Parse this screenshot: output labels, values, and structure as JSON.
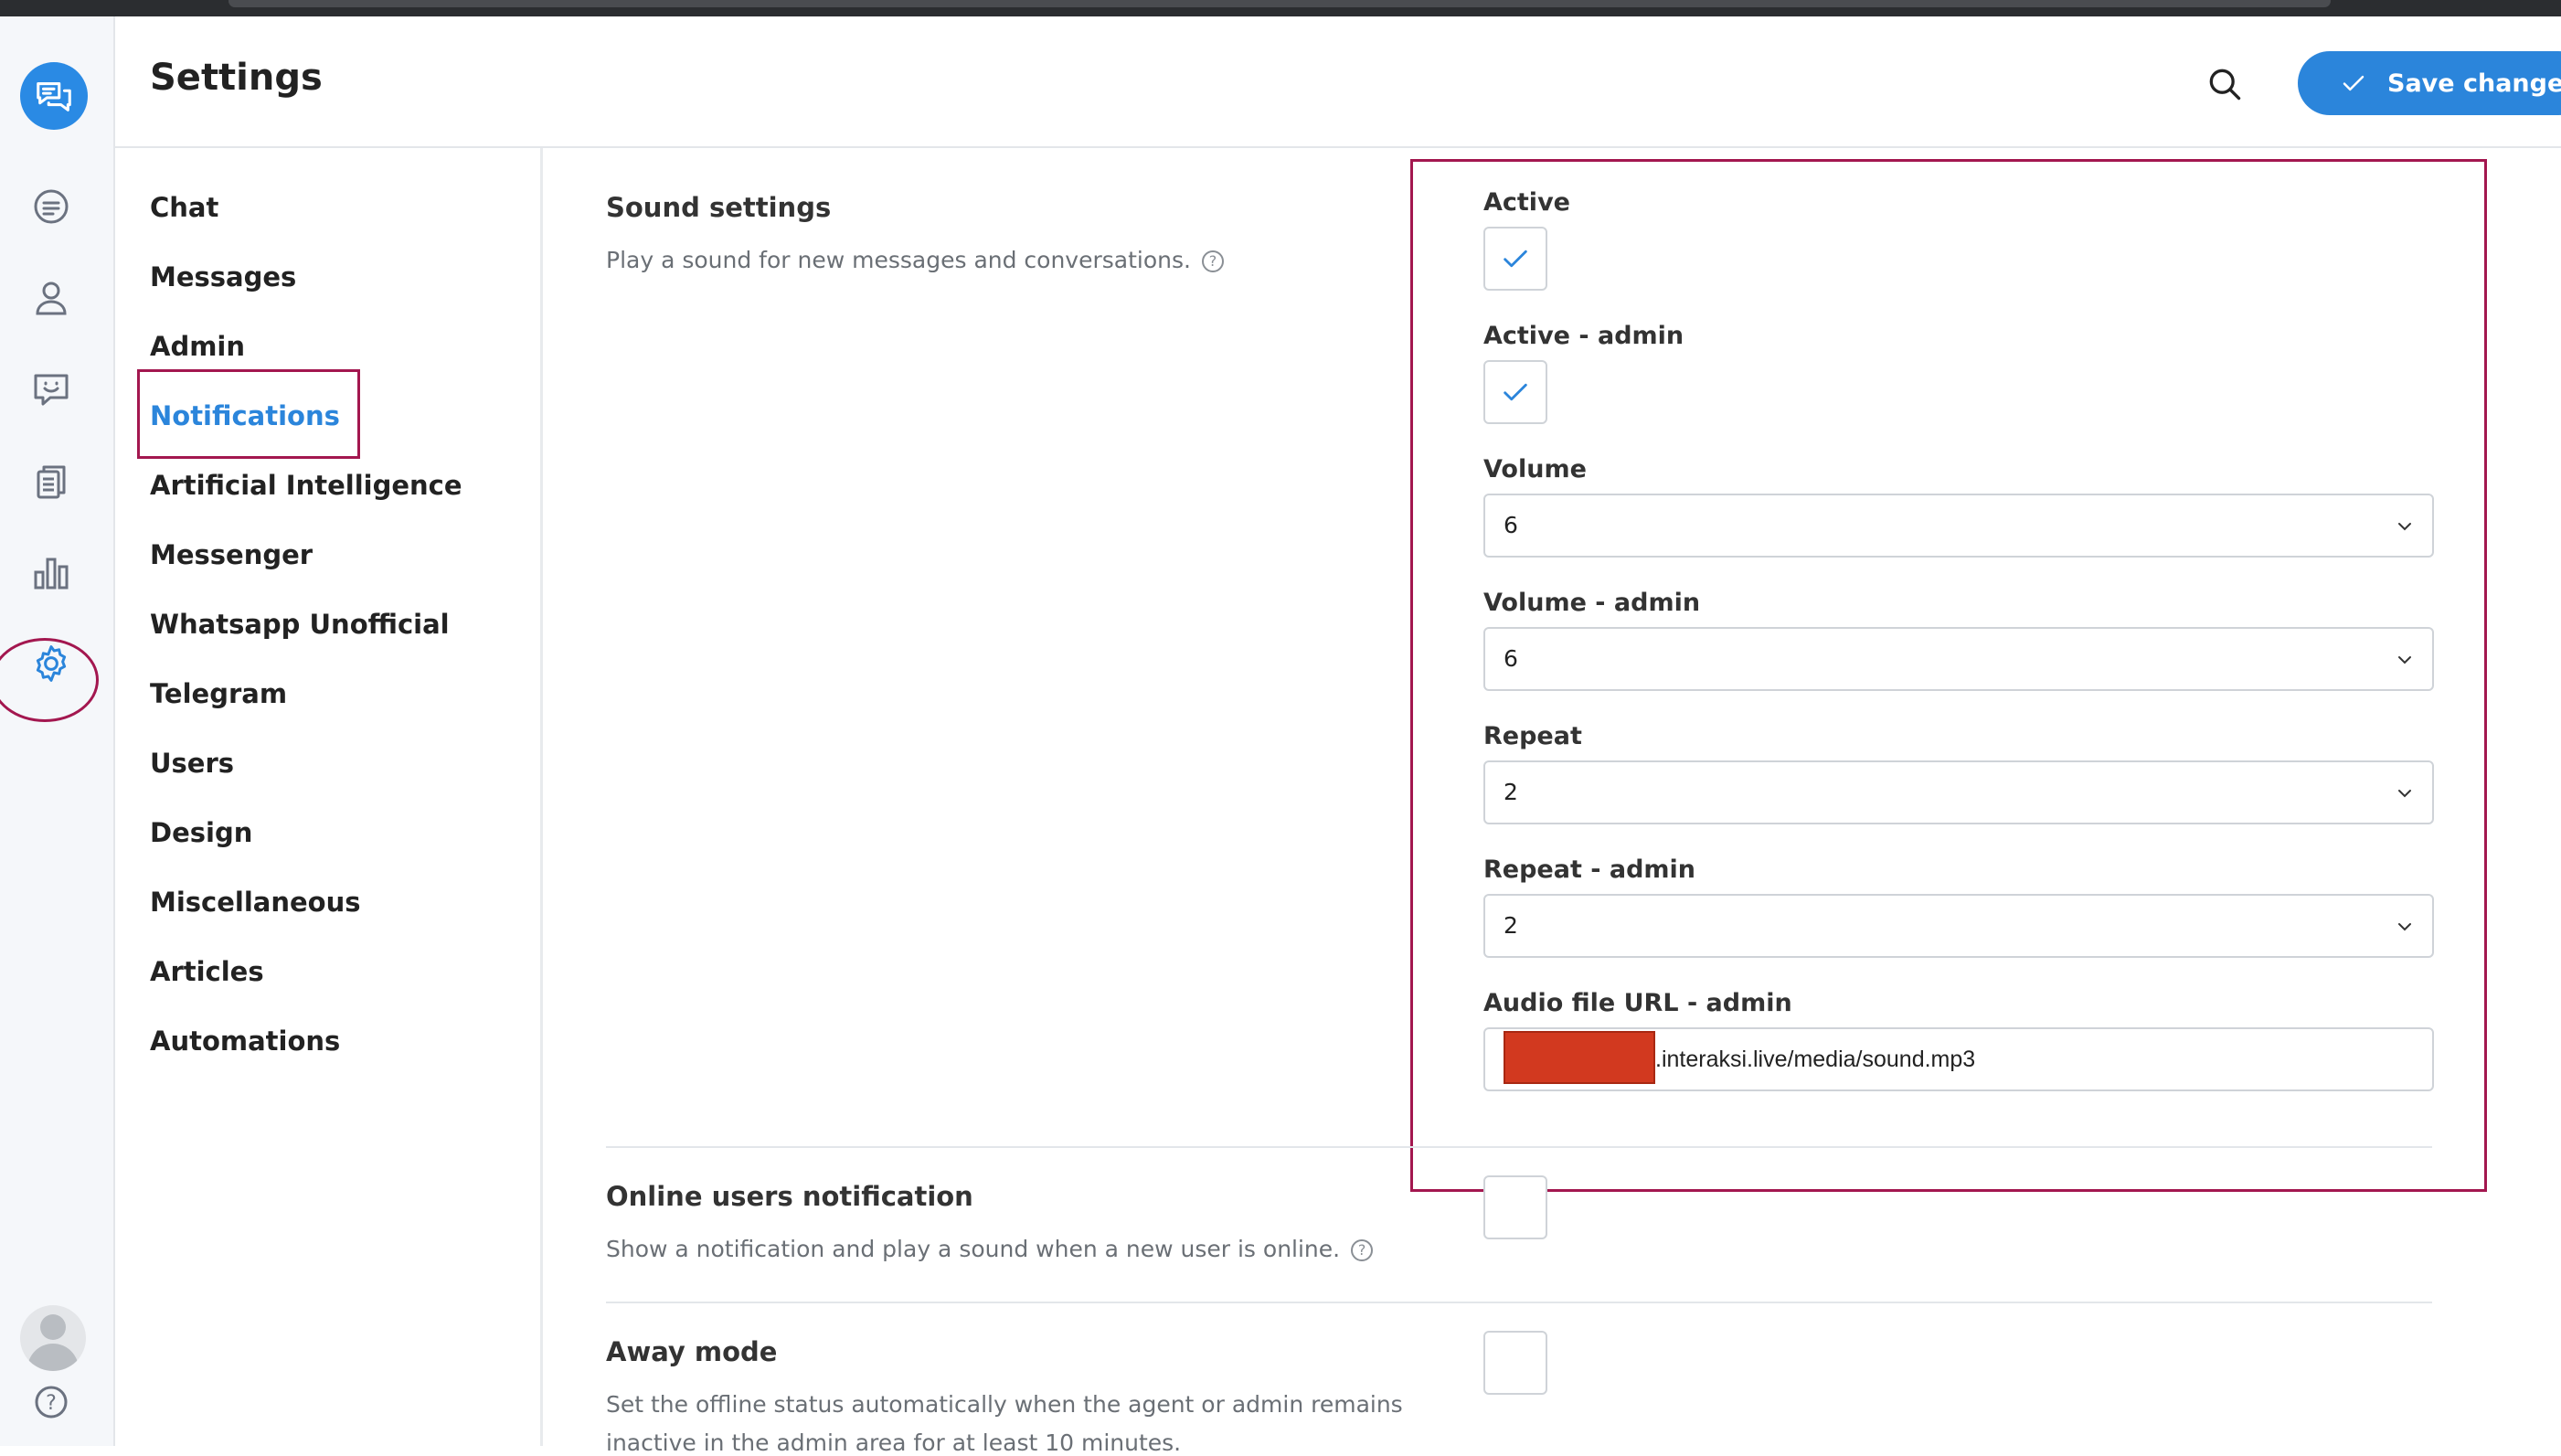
{
  "header": {
    "title": "Settings",
    "save_label": "Save changes"
  },
  "nav": {
    "items": [
      {
        "label": "Chat"
      },
      {
        "label": "Messages"
      },
      {
        "label": "Admin"
      },
      {
        "label": "Notifications",
        "active": true
      },
      {
        "label": "Artificial Intelligence"
      },
      {
        "label": "Messenger"
      },
      {
        "label": "Whatsapp Unofficial"
      },
      {
        "label": "Telegram"
      },
      {
        "label": "Users"
      },
      {
        "label": "Design"
      },
      {
        "label": "Miscellaneous"
      },
      {
        "label": "Articles"
      },
      {
        "label": "Automations"
      }
    ]
  },
  "rail": {
    "icons": [
      "chat-bubble-icon",
      "user-icon",
      "smile-chat-icon",
      "documents-icon",
      "bar-chart-icon",
      "gear-icon"
    ],
    "help_glyph": "?"
  },
  "sound_settings": {
    "title": "Sound settings",
    "description": "Play a sound for new messages and conversations.",
    "active_label": "Active",
    "active_checked": true,
    "active_admin_label": "Active - admin",
    "active_admin_checked": true,
    "volume_label": "Volume",
    "volume_value": "6",
    "volume_admin_label": "Volume - admin",
    "volume_admin_value": "6",
    "repeat_label": "Repeat",
    "repeat_value": "2",
    "repeat_admin_label": "Repeat - admin",
    "repeat_admin_value": "2",
    "audio_label": "Audio file URL - admin",
    "audio_value": ".interaksi.live/media/sound.mp3"
  },
  "online_users": {
    "title": "Online users notification",
    "description": "Show a notification and play a sound when a new user is online.",
    "checked": false
  },
  "away_mode": {
    "title": "Away mode",
    "description": "Set the offline status automatically when the agent or admin remains",
    "description_cont": "inactive in the admin area for at least 10 minutes.",
    "checked": false
  },
  "help_glyph": "?",
  "colors": {
    "accent": "#2b85db",
    "highlight": "#a3174f",
    "redaction": "#d2391f"
  }
}
